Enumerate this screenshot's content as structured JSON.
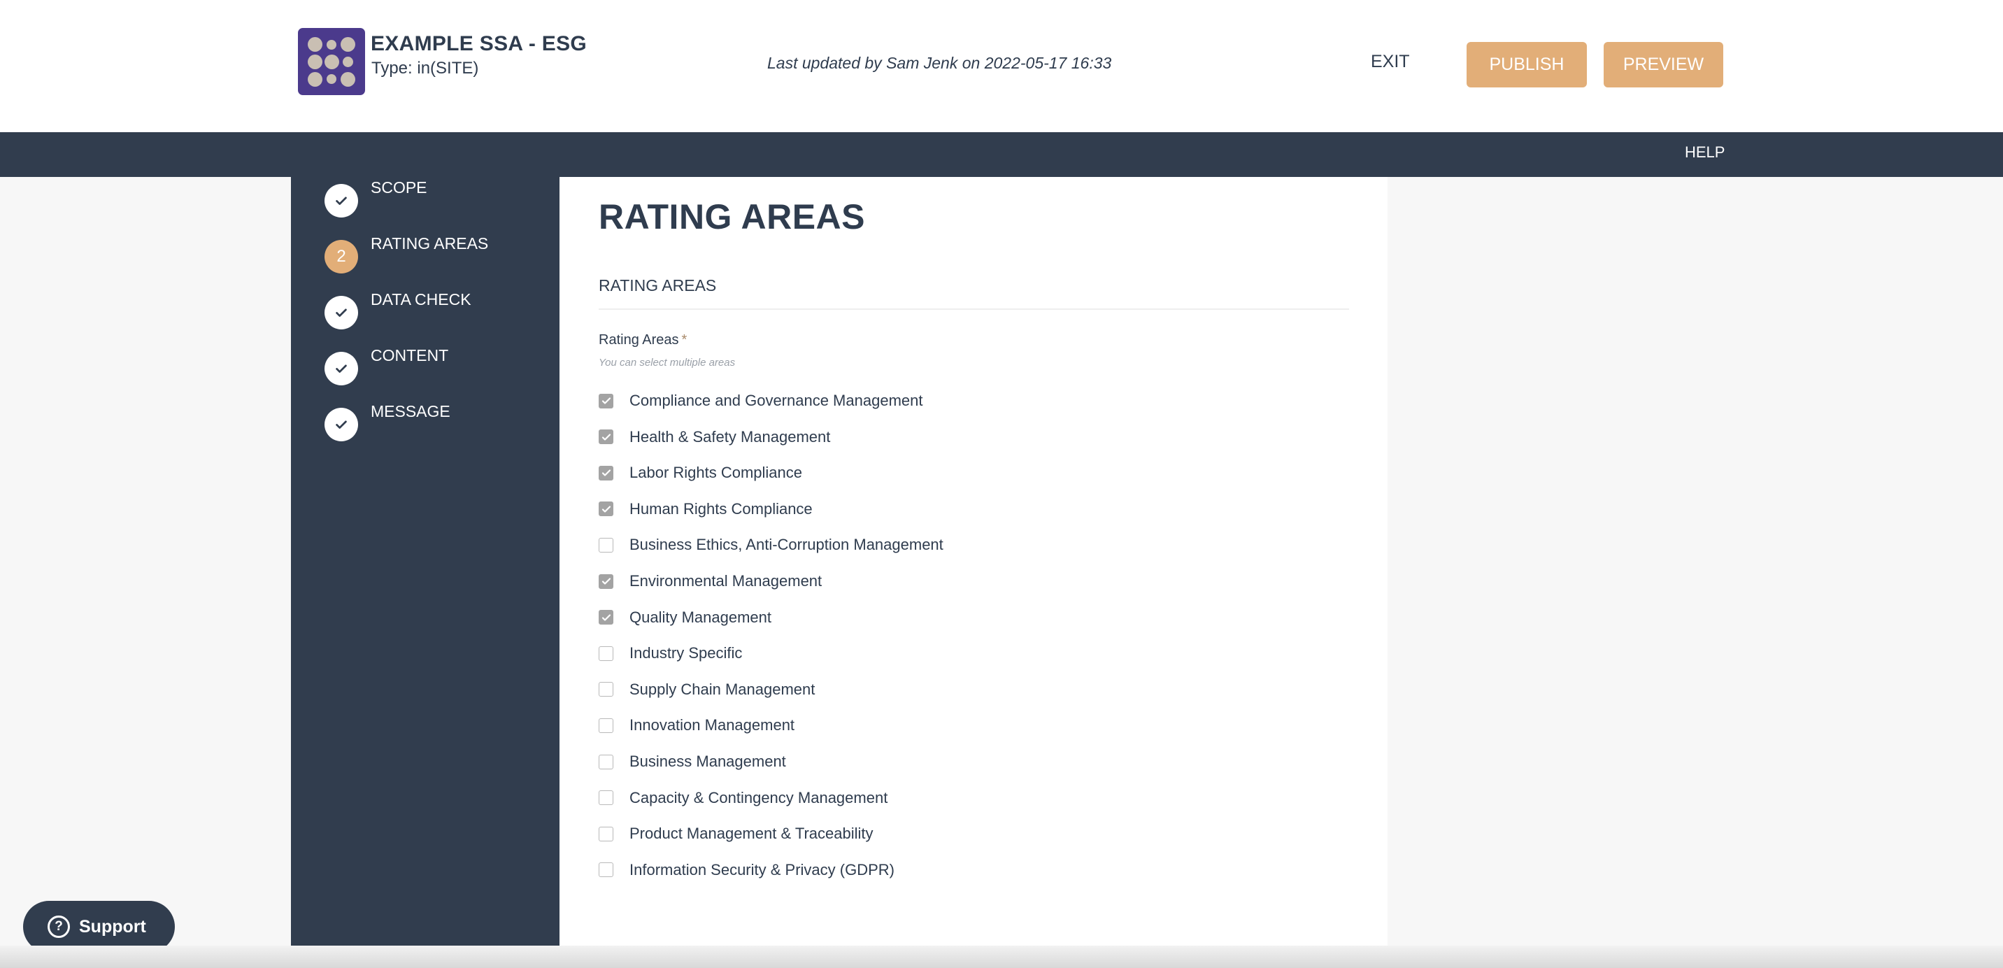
{
  "header": {
    "title": "EXAMPLE SSA - ESG",
    "type_label": "Type: in(SITE)",
    "last_updated": "Last updated by Sam Jenk on 2022-05-17 16:33",
    "logo_icon": "dot-grid-logo-icon",
    "exit_label": "EXIT",
    "publish_label": "PUBLISH",
    "preview_label": "PREVIEW"
  },
  "navbar": {
    "help_label": "HELP"
  },
  "steps": [
    {
      "label": "SCOPE",
      "status": "complete",
      "icon": "check-icon"
    },
    {
      "label": "RATING AREAS",
      "status": "active",
      "number": "2"
    },
    {
      "label": "DATA CHECK",
      "status": "complete",
      "icon": "check-icon"
    },
    {
      "label": "CONTENT",
      "status": "complete",
      "icon": "check-icon"
    },
    {
      "label": "MESSAGE",
      "status": "complete",
      "icon": "check-icon"
    }
  ],
  "main": {
    "page_title": "RATING AREAS",
    "section_title": "RATING AREAS",
    "field_label": "Rating Areas",
    "required_marker": "*",
    "hint": "You can select multiple areas",
    "options": [
      {
        "label": "Compliance and Governance Management",
        "checked": true
      },
      {
        "label": "Health & Safety Management",
        "checked": true
      },
      {
        "label": "Labor Rights Compliance",
        "checked": true
      },
      {
        "label": "Human Rights Compliance",
        "checked": true
      },
      {
        "label": "Business Ethics, Anti-Corruption Management",
        "checked": false
      },
      {
        "label": "Environmental Management",
        "checked": true
      },
      {
        "label": "Quality Management",
        "checked": true
      },
      {
        "label": "Industry Specific",
        "checked": false
      },
      {
        "label": "Supply Chain Management",
        "checked": false
      },
      {
        "label": "Innovation Management",
        "checked": false
      },
      {
        "label": "Business Management",
        "checked": false
      },
      {
        "label": "Capacity & Contingency Management",
        "checked": false
      },
      {
        "label": "Product Management & Traceability",
        "checked": false
      },
      {
        "label": "Information Security & Privacy (GDPR)",
        "checked": false
      }
    ]
  },
  "support": {
    "label": "Support",
    "icon": "question-circle-icon"
  },
  "colors": {
    "brand_dark": "#313d4e",
    "accent": "#e2ae78",
    "logo_bg": "#4b3a8c",
    "checkbox_checked": "#a3a3a3"
  }
}
